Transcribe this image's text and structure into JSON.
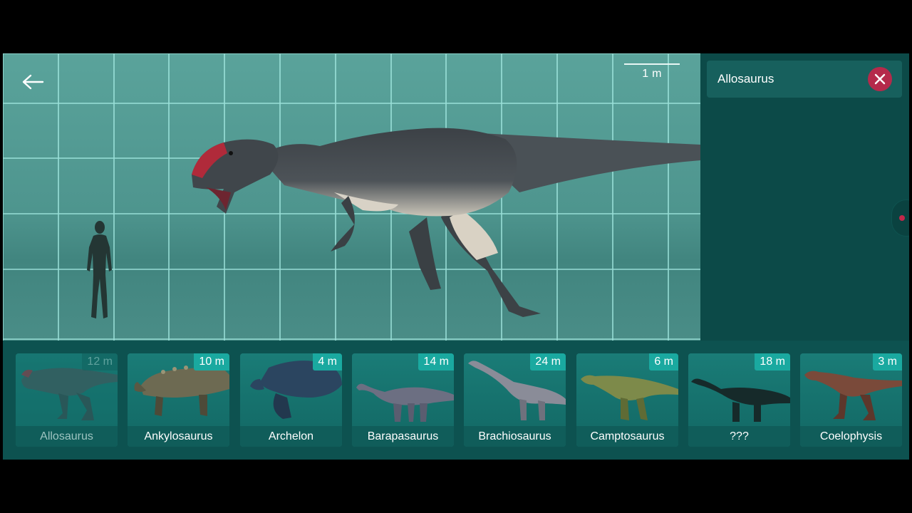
{
  "viewer": {
    "scale_label": "1 m",
    "subject": "Allosaurus"
  },
  "search": {
    "value": "Allosaurus"
  },
  "colors": {
    "accent": "#1aa9a0",
    "clear_button": "#b52a4b",
    "background": "#0c4a48"
  },
  "carousel": {
    "items": [
      {
        "name": "Allosaurus",
        "size": "12 m",
        "selected": true
      },
      {
        "name": "Ankylosaurus",
        "size": "10 m"
      },
      {
        "name": "Archelon",
        "size": "4 m"
      },
      {
        "name": "Barapasaurus",
        "size": "14 m"
      },
      {
        "name": "Brachiosaurus",
        "size": "24 m"
      },
      {
        "name": "Camptosaurus",
        "size": "6 m"
      },
      {
        "name": "???",
        "size": "18 m"
      },
      {
        "name": "Coelophysis",
        "size": "3 m"
      }
    ]
  }
}
